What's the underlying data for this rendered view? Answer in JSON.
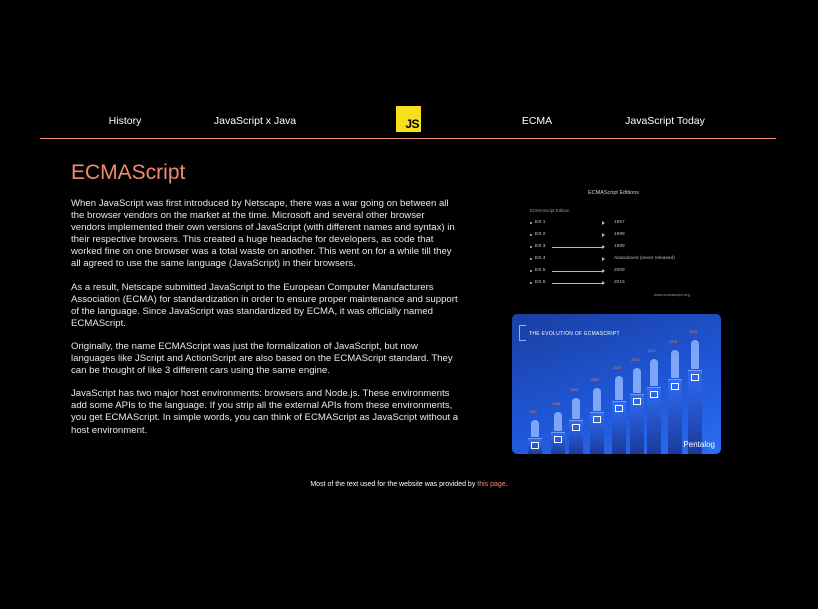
{
  "nav": {
    "items": [
      {
        "label": "History"
      },
      {
        "label": "JavaScript x Java"
      },
      {
        "label": "ECMA"
      },
      {
        "label": "JavaScript Today"
      }
    ],
    "logo_text": "JS",
    "accent_color": "#f28b6e",
    "logo_color": "#f7df1e"
  },
  "main": {
    "title": "ECMAScript",
    "paragraphs": [
      "When JavaScript was first introduced by Netscape, there was a war going on between all the browser vendors on the market at the time. Microsoft and several other browser vendors implemented their own versions of JavaScript (with different names and syntax) in their respective browsers. This created a huge headache for developers, as code that worked fine on one browser was a total waste on another. This went on for a while till they all agreed to use the same language (JavaScript) in their browsers.",
      "As a result, Netscape submitted JavaScript to the European Computer Manufacturers Association (ECMA) for standardization in order to ensure proper maintenance and support of the language. Since JavaScript was standardized by ECMA, it was officially named ECMAScript.",
      "Originally, the name ECMAScript was just the formalization of JavaScript, but now languages like JScript and ActionScript are also based on the ECMAScript standard. They can be thought of like 3 different cars using the same engine.",
      "JavaScript has two major host environments: browsers and Node.js. These environments add some APIs to the language. If you strip all the external APIs from these environments, you get ECMAScript. In simple words, you can think of ECMAScript as JavaScript without a host environment."
    ]
  },
  "editions_image": {
    "title": "ECMAScript Editions",
    "header": "ECMAScript Edition",
    "rows": [
      {
        "name": "ES 1",
        "year": "1997"
      },
      {
        "name": "ES 2",
        "year": "1998"
      },
      {
        "name": "ES 3",
        "year": "1999"
      },
      {
        "name": "ES 4",
        "year": "Abandoned (never released)"
      },
      {
        "name": "ES 5",
        "year": "2009"
      },
      {
        "name": "ES 6",
        "year": "2015"
      }
    ],
    "source": "www.ecmascript.org"
  },
  "evolution_image": {
    "title": "THE EVOLUTION OF ECMASCRIPT",
    "brand": "Pentalog",
    "years": [
      "1997",
      "1998",
      "1999",
      "2009",
      "2015",
      "2016",
      "2017",
      "2018",
      "2019"
    ]
  },
  "footer": {
    "text": "Most of the text used for the website was provided by ",
    "link_text": "this page",
    "suffix": "."
  }
}
